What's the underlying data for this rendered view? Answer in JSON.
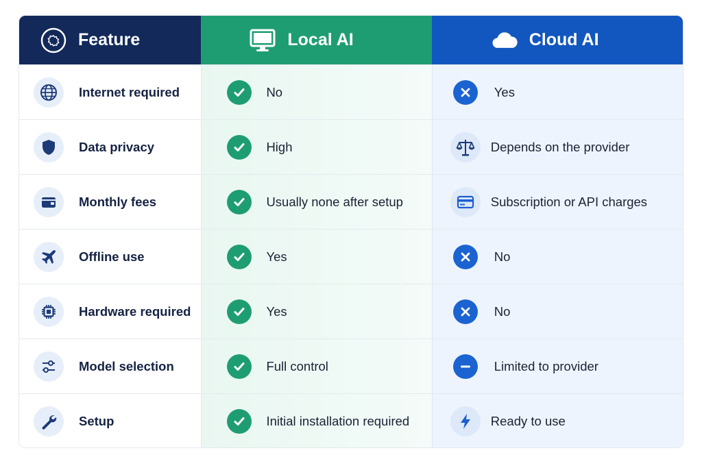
{
  "header": {
    "feature": "Feature",
    "local": "Local AI",
    "cloud": "Cloud AI"
  },
  "colors": {
    "header_feature": "#13295a",
    "header_local": "#1f9d72",
    "header_cloud": "#1257bf",
    "check": "#1f9d72",
    "cross": "#1b63d1"
  },
  "rows": [
    {
      "feature": "Internet required",
      "feature_icon": "globe-icon",
      "local": "No",
      "local_icon": "check-icon",
      "cloud": "Yes",
      "cloud_icon": "cross-icon"
    },
    {
      "feature": "Data privacy",
      "feature_icon": "shield-icon",
      "local": "High",
      "local_icon": "check-icon",
      "cloud": "Depends on the provider",
      "cloud_icon": "scale-icon"
    },
    {
      "feature": "Monthly fees",
      "feature_icon": "wallet-icon",
      "local": "Usually none after setup",
      "local_icon": "check-icon",
      "cloud": "Subscription or API charges",
      "cloud_icon": "credit-card-icon"
    },
    {
      "feature": "Offline use",
      "feature_icon": "airplane-icon",
      "local": "Yes",
      "local_icon": "check-icon",
      "cloud": "No",
      "cloud_icon": "cross-icon"
    },
    {
      "feature": "Hardware required",
      "feature_icon": "chip-icon",
      "local": "Yes",
      "local_icon": "check-icon",
      "cloud": "No",
      "cloud_icon": "cross-icon"
    },
    {
      "feature": "Model selection",
      "feature_icon": "sliders-icon",
      "local": "Full control",
      "local_icon": "check-icon",
      "cloud": "Limited to provider",
      "cloud_icon": "minus-icon"
    },
    {
      "feature": "Setup",
      "feature_icon": "wrench-icon",
      "local": "Initial installation required",
      "local_icon": "check-icon",
      "cloud": "Ready to use",
      "cloud_icon": "lightning-icon"
    }
  ]
}
